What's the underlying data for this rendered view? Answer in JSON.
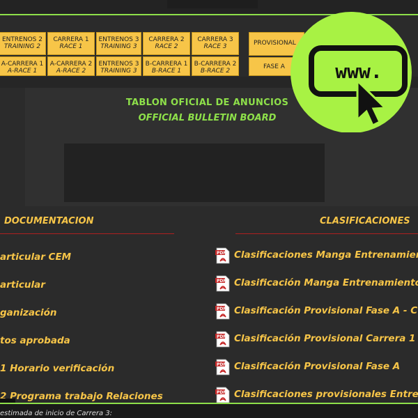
{
  "nav": {
    "row1": [
      {
        "l1": "ENTRENOS 2",
        "l2": "TRAINING 2"
      },
      {
        "l1": "CARRERA 1",
        "l2": "RACE 1"
      },
      {
        "l1": "ENTRENOS 3",
        "l2": "TRAINING 3"
      },
      {
        "l1": "CARRERA 2",
        "l2": "RACE 2"
      },
      {
        "l1": "CARRERA 3",
        "l2": "RACE 3"
      }
    ],
    "row2": [
      {
        "l1": "A-CARRERA 1",
        "l2": "A-RACE 1"
      },
      {
        "l1": "A-CARRERA 2",
        "l2": "A-RACE 2"
      },
      {
        "l1": "ENTRENOS 3",
        "l2": "TRAINING 3"
      },
      {
        "l1": "B-CARRERA 1",
        "l2": "B-RACE 1"
      },
      {
        "l1": "B-CARRERA 2",
        "l2": "B-RACE 2"
      }
    ],
    "provisional": "PROVISIONAL",
    "fase": "FASE A"
  },
  "board": {
    "title": "TABLON OFICIAL DE ANUNCIOS",
    "subtitle": "OFFICIAL BULLETIN BOARD"
  },
  "sections": {
    "documentacion": "DOCUMENTACION",
    "clasificaciones": "CLASIFICACIONES"
  },
  "docs": [
    "articular CEM",
    "articular",
    "ganización",
    "tos aprobada",
    "1 Horario verificación",
    "2 Programa trabajo Relaciones"
  ],
  "clasificaciones": [
    "Clasificaciones Manga Entrenamiento",
    "Clasificación Manga Entrenamiento",
    "Clasificación Provisional Fase A - C",
    "Clasificación Provisional Carrera 1",
    "Clasificación Provisional Fase A",
    "Clasificaciones provisionales Entre"
  ],
  "footer": "estimada de inicio de Carrera 3:",
  "icons": {
    "pdf": "pdf-icon",
    "www": "www-cursor-icon"
  },
  "colors": {
    "accent": "#8ee04a",
    "gold": "#f7c548",
    "rule": "#b02020"
  }
}
